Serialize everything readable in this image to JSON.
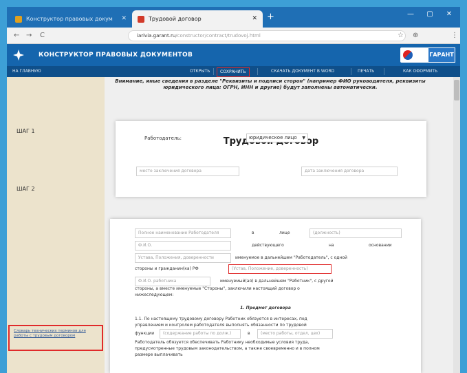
{
  "browser": {
    "tabs": [
      {
        "label": "Конструктор правовых докум"
      },
      {
        "label": "Трудовой договор"
      }
    ],
    "new_tab": "+",
    "window_controls": [
      "—",
      "▢",
      "✕"
    ],
    "nav": {
      "back": "←",
      "forward": "→",
      "reload": "C"
    },
    "url_host": "iarivia.garant.ru",
    "url_path": "/constructor/contract/trudovoj.html",
    "tools": [
      "☆",
      "⊕",
      "⋮"
    ]
  },
  "site": {
    "title": "КОНСТРУКТОР ПРАВОВЫХ ДОКУМЕНТОВ",
    "brand": "ГАРАНТ"
  },
  "menu": {
    "home": "НА ГЛАВНУЮ",
    "open": "ОТКРЫТЬ",
    "save": "СОХРАНИТЬ",
    "download": "СКАЧАТЬ ДОКУМЕНТ В WORD",
    "print": "ПЕЧАТЬ",
    "help": "КАК ОФОРМИТЬ"
  },
  "notice": "Внимание, иные сведения в разделе \"Реквизиты и подписи сторон\" (например ФИО руководителя, реквизиты юридического лица: ОГРН, ИНН и другие) будут заполнены автоматически.",
  "steps": {
    "step1": "ШАГ 1",
    "step2": "ШАГ 2"
  },
  "sidebar_link": "Словарь технических терминов для работы с трудовым договором",
  "doc": {
    "title": "Трудовой договор",
    "place_placeholder": "место заключения договора",
    "date_placeholder": "дата заключения договора"
  },
  "employer": {
    "label": "Работодатель:",
    "select_value": "юридическое лицо"
  },
  "form": {
    "org_name_placeholder": "Полное наименование Работодателя",
    "in_person": "в",
    "in_person_2": "лице",
    "position_placeholder": "(должность)",
    "fio_placeholder": "Ф.И.О.",
    "acting": "действующего",
    "on": "на",
    "basis": "основании",
    "charter_placeholder": "Устава, Положения, доверенности",
    "employer_ref": "именуемое в дальнейшем \"Работодатель\", с одной",
    "side_text": "стороны и гражданин(ка) РФ",
    "passport_placeholder": "(Устав, Положение, доверенность)",
    "worker_fio_placeholder": "Ф.И.О. работника",
    "worker_ref": "именуемый(ая) в дальнейшем \"Работник\", с другой",
    "other_sides": "стороны, а вместе именуемые \"Стороны\", заключили настоящий договор о",
    "following": "нижеследующем:",
    "section1": "1. Предмет договора",
    "p1_line1": "1.1. По настоящему трудовому договору Работник обязуется в интересах, под",
    "p1_line2": "управлением и контролем работодателя выполнять обязанности по трудовой",
    "p1_line3_start": "функции",
    "job_placeholder": "(содержание работы по долж.)",
    "p1_line3_mid": "в",
    "dept_placeholder": "(место работы, отдел, цех)",
    "p1_line4": "Работодатель обязуется обеспечивать Работнику необходимые условия труда,",
    "p1_line5": "предусмотренные трудовым законодательством, а также своевременно и в полном",
    "p1_line6": "размере выплачивать"
  }
}
